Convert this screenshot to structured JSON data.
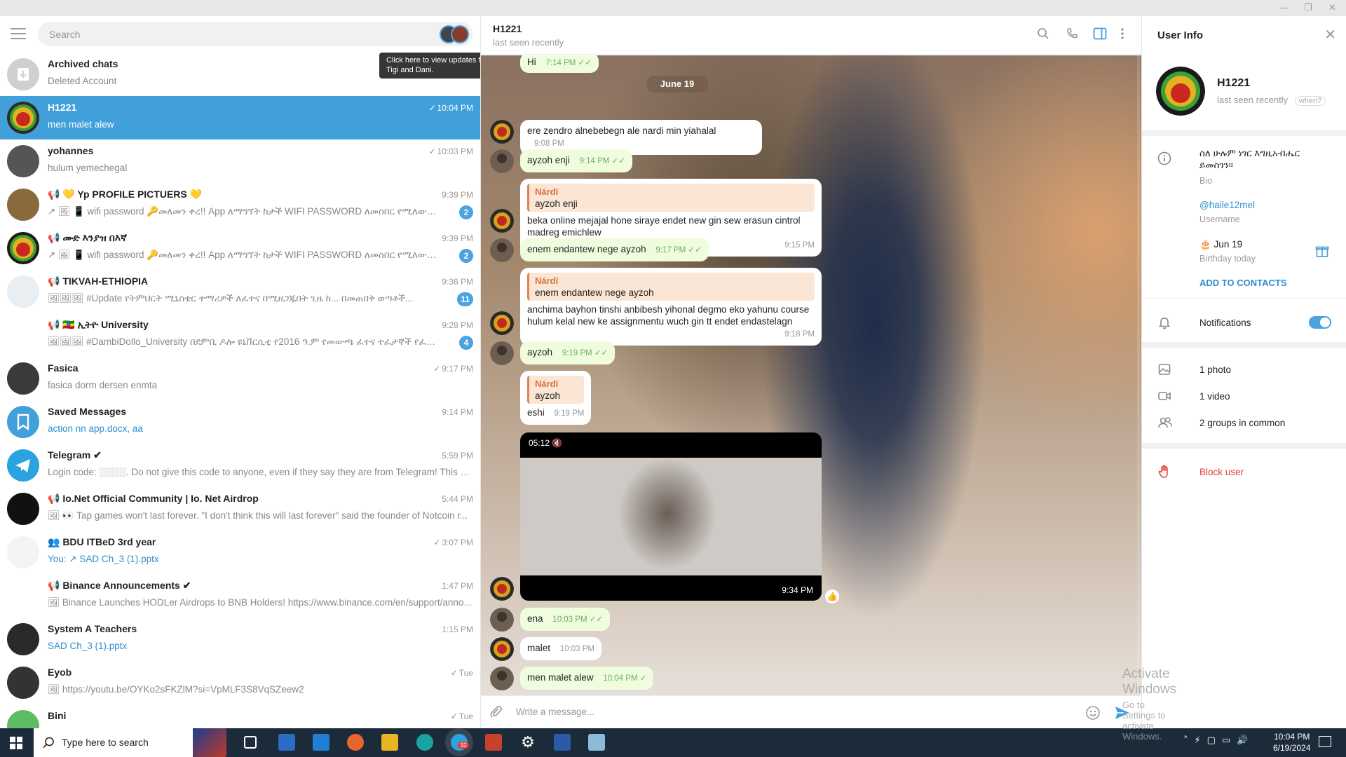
{
  "left": {
    "search_placeholder": "Search",
    "tooltip": "Click here to view updates from Tigi and Dani.",
    "chats": [
      {
        "name": "Archived chats",
        "preview": "Deleted Account",
        "time": "",
        "badge": "",
        "check": "",
        "preview_blue": false
      },
      {
        "name": "H1221",
        "preview": "men malet alew",
        "time": "10:04 PM",
        "badge": "",
        "check": "✓",
        "preview_blue": false,
        "active": true
      },
      {
        "name": "yohannes",
        "preview": "hulum yemechegal",
        "time": "10:03 PM",
        "badge": "",
        "check": "✓",
        "preview_blue": false
      },
      {
        "name": "📢 💛 Yp PROFILE PICTUERS 💛",
        "preview": "↗ 🖼 📱 wifi password 🔑መለመን ቀረ!! App ለማግኘት ከታች WIFI PASSWORD ለመስበር የሚለውን ይጎ...",
        "time": "9:39 PM",
        "badge": "2",
        "check": "",
        "preview_blue": false
      },
      {
        "name": "📢 ሙድ እንያዝ በእኛ",
        "preview": "↗ 🖼 📱 wifi password 🔑መለመን ቀረ!! App ለማግኘት ከታች WIFI PASSWORD ለመስበር የሚለውን ይጎ...",
        "time": "9:39 PM",
        "badge": "2",
        "check": "",
        "preview_blue": false
      },
      {
        "name": "📢 TIKVAH-ETHIOPIA",
        "preview": "🖼🖼🖼 #Update የትምህርት ሚኒስቴር ተማሪዎች ለፈተና በሚዘጋጁበት ጊዜ ከ... በመጠበቅ ወጣቶች...",
        "time": "9:36 PM",
        "badge": "11",
        "check": "",
        "preview_blue": false
      },
      {
        "name": "📢 🇪🇹 ኢትዮ University",
        "preview": "🖼🖼🖼 #DambiDollo_University በደምቢ ዶሎ ዩኒቨርሲቲ የ2016 ዓ.ም የመውጫ ፈተና ተፈታኞች የፈተና መር...",
        "time": "9:28 PM",
        "badge": "4",
        "check": "",
        "preview_blue": false
      },
      {
        "name": "Fasica",
        "preview": "fasica dorm dersen enmta",
        "time": "9:17 PM",
        "badge": "",
        "check": "✓",
        "preview_blue": false
      },
      {
        "name": "Saved Messages",
        "preview": "action nn app.docx, aa",
        "time": "9:14 PM",
        "badge": "",
        "check": "",
        "preview_blue": true
      },
      {
        "name": "Telegram ✔",
        "preview": "Login code: ░░░░. Do not give this code to anyone, even if they say they are from Telegram!  This cod...",
        "time": "5:59 PM",
        "badge": "",
        "check": "",
        "preview_blue": false
      },
      {
        "name": "📢 Io.Net Official Community | Io. Net Airdrop",
        "preview": "🖼 👀 Tap games won't last forever.  \"I don't think this will last forever\" said the founder of Notcoin r...",
        "time": "5:44 PM",
        "badge": "",
        "check": "",
        "preview_blue": false
      },
      {
        "name": "👥 BDU ITBeD 3rd year",
        "preview": "You: ↗ SAD Ch_3 (1).pptx",
        "time": "3:07 PM",
        "badge": "",
        "check": "✓",
        "preview_blue": true
      },
      {
        "name": "📢 Binance Announcements ✔",
        "preview": "🖼 Binance Launches HODLer Airdrops to BNB Holders! https://www.binance.com/en/support/anno...",
        "time": "1:47 PM",
        "badge": "",
        "check": "",
        "preview_blue": false
      },
      {
        "name": "System A Teachers",
        "preview": "SAD Ch_3 (1).pptx",
        "time": "1:15 PM",
        "badge": "",
        "check": "",
        "preview_blue": true
      },
      {
        "name": "Eyob",
        "preview": "🖼 https://youtu.be/OYKo2sFKZlM?si=VpMLF3S8VqSZeew2",
        "time": "Tue",
        "badge": "",
        "check": "✓",
        "preview_blue": false
      },
      {
        "name": "Bini",
        "preview": "",
        "time": "Tue",
        "badge": "",
        "check": "✓",
        "preview_blue": false
      }
    ]
  },
  "chat": {
    "title": "H1221",
    "status": "last seen recently",
    "date_pill": "June 19",
    "input_placeholder": "Write a message...",
    "messages": {
      "m0": {
        "text": "Hi",
        "time": "7:14 PM"
      },
      "m1": {
        "text": "ere zendro alnebebegn ale nardi min yiahalal",
        "time": "9:08 PM"
      },
      "m2": {
        "text": "ayzoh enji",
        "time": "9:14 PM"
      },
      "m3": {
        "reply_name": "Nárdï",
        "reply_text": "ayzoh enji",
        "text": "beka online mejajal hone siraye endet new gin sew erasun cintrol madreg emichlew",
        "time": "9:15 PM"
      },
      "m4": {
        "text": "enem endantew nege ayzoh",
        "time": "9:17 PM"
      },
      "m5": {
        "reply_name": "Nárdï",
        "reply_text": "enem endantew nege ayzoh",
        "text": "anchima bayhon tinshi anbibesh yihonal degmo eko yahunu course hulum kelal new ke assignmentu wuch gin tt endet endastelagn",
        "time": "9:18 PM"
      },
      "m6": {
        "text": "ayzoh",
        "time": "9:19 PM"
      },
      "m7": {
        "reply_name": "Nárdï",
        "reply_text": "ayzoh",
        "text": "eshi",
        "time": "9:19 PM"
      },
      "video": {
        "duration": "05:12",
        "time": "9:34 PM",
        "reaction": "👍"
      },
      "m8": {
        "text": "ena",
        "time": "10:03 PM"
      },
      "m9": {
        "text": "malet",
        "time": "10:03 PM"
      },
      "m10": {
        "text": "men malet alew",
        "time": "10:04 PM"
      }
    }
  },
  "watermark": {
    "line1": "Activate Windows",
    "line2": "Go to Settings to activate Windows."
  },
  "user_info": {
    "header": "User Info",
    "name": "H1221",
    "status": "last seen recently",
    "when": "when?",
    "bio": "ስለ ሁሉም ነገር እግዚአብሔር ይመስገን።",
    "bio_label": "Bio",
    "username": "@haile12mel",
    "username_label": "Username",
    "birthday": "🎂 Jun 19",
    "birthday_label": "Birthday today",
    "add_contacts": "ADD TO CONTACTS",
    "notifications": "Notifications",
    "notifications_on": true,
    "photos": "1 photo",
    "videos": "1 video",
    "groups": "2 groups in common",
    "block": "Block user"
  },
  "taskbar": {
    "search_placeholder": "Type here to search",
    "telegram_badge": "32",
    "time": "10:04 PM",
    "date": "6/19/2024"
  },
  "colors": {
    "accent": "#419fd9",
    "bubble": "#effdde",
    "reply_accent": "#e0814e",
    "block_red": "#e53935",
    "taskbar": "#1c2b3a"
  }
}
